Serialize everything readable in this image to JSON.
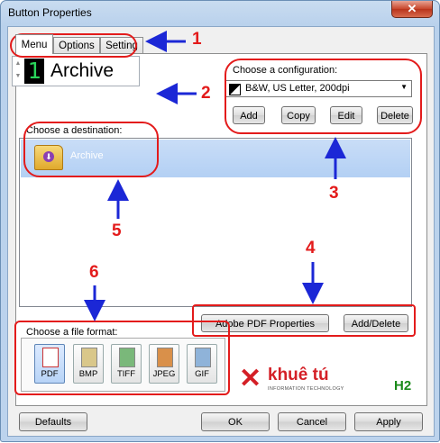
{
  "window": {
    "title": "Button Properties",
    "close_glyph": "✕"
  },
  "tabs": [
    {
      "label": "Menu",
      "active": true
    },
    {
      "label": "Options",
      "active": false
    },
    {
      "label": "Setting",
      "active": false
    }
  ],
  "spinner": {
    "digit": "1",
    "label": "Archive"
  },
  "configuration": {
    "label": "Choose a configuration:",
    "selected": "B&W, US Letter, 200dpi",
    "buttons": {
      "add": "Add",
      "copy": "Copy",
      "edit": "Edit",
      "delete": "Delete"
    }
  },
  "destination": {
    "label": "Choose a destination:",
    "items": [
      {
        "label": "Archive",
        "icon": "folder-icon"
      }
    ]
  },
  "destination_buttons": {
    "pdf_properties": "Adobe PDF Properties",
    "add_delete": "Add/Delete"
  },
  "file_format": {
    "label": "Choose a file format:",
    "items": [
      "PDF",
      "BMP",
      "TIFF",
      "JPEG",
      "GIF"
    ],
    "selected": "PDF"
  },
  "logo": {
    "brand": "khuê tú",
    "tagline": "INFORMATION TECHNOLOGY"
  },
  "watermark": "H2",
  "footer": {
    "defaults": "Defaults",
    "ok": "OK",
    "cancel": "Cancel",
    "apply": "Apply"
  },
  "annotations": {
    "n1": "1",
    "n2": "2",
    "n3": "3",
    "n4": "4",
    "n5": "5",
    "n6": "6",
    "color": "#e31b1b",
    "arrow_color": "#1b27d6"
  }
}
